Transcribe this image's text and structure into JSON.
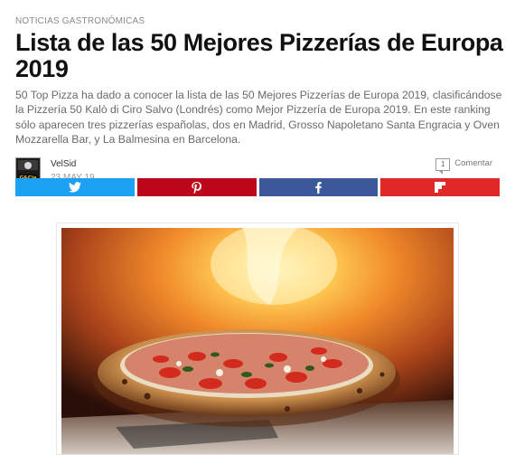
{
  "article": {
    "category": "NOTICIAS GASTRONÓMICAS",
    "title": "Lista de las 50 Mejores Pizzerías de Europa 2019",
    "lead": "50 Top Pizza ha dado a conocer la lista de las 50 Mejores Pizzerías de Europa 2019, clasificándose la Pizzería 50 Kalò di Ciro Salvo (Londrés) como Mejor Pizzería de Europa 2019. En este ranking sólo aparecen tres pizzerías españolas, dos en Madrid, Grosso Napoletano Santa Engracia y Oven Mozzarella Bar, y La Balmesina en Barcelona."
  },
  "meta": {
    "author": "VelSid",
    "date": "23 MAY 19",
    "avatar_text": "G&Cia",
    "comment_count": "1",
    "comment_label": "Comentar"
  },
  "share": [
    {
      "network": "twitter",
      "icon": "twitter-bird-icon",
      "color": "#1da1f2"
    },
    {
      "network": "pinterest",
      "icon": "pinterest-p-icon",
      "color": "#bd081c"
    },
    {
      "network": "facebook",
      "icon": "facebook-f-icon",
      "color": "#3b5998"
    },
    {
      "network": "flipboard",
      "icon": "flipboard-icon",
      "color": "#e12828"
    }
  ],
  "figure": {
    "subject": "pizza-in-wood-fired-oven-photo"
  }
}
